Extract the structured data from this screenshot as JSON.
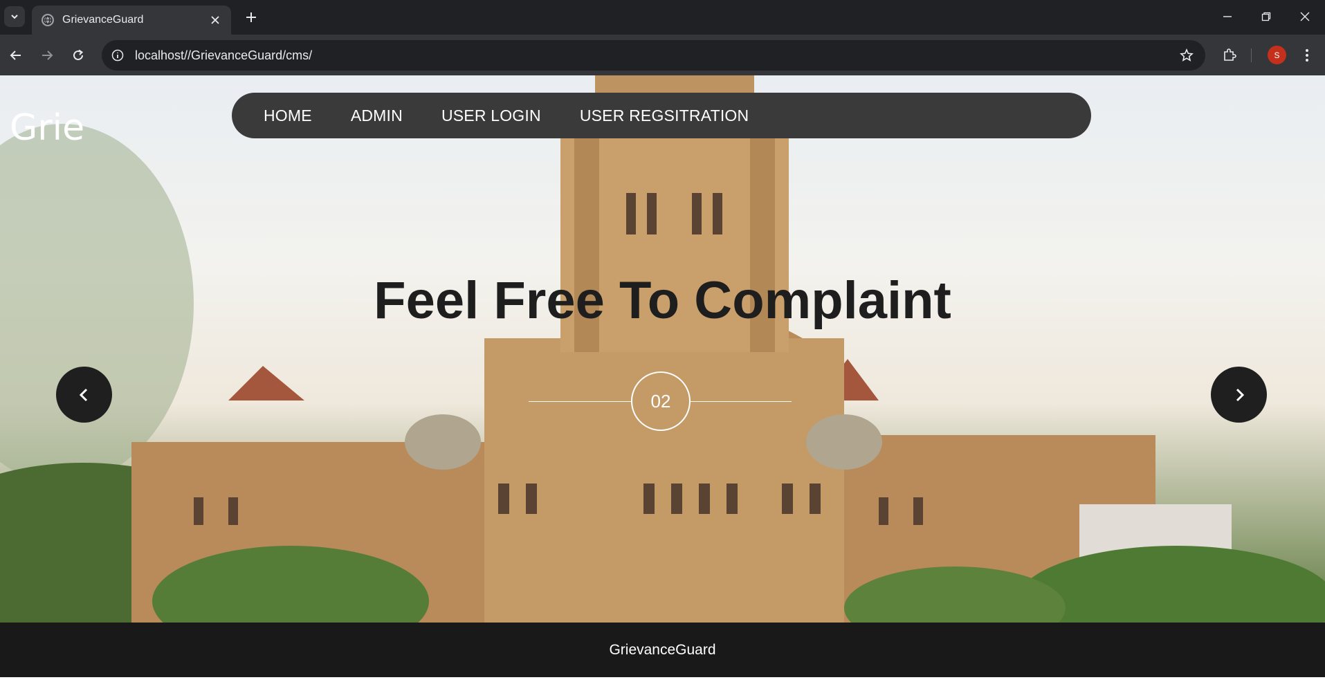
{
  "browser": {
    "tab_title": "GrievanceGuard",
    "url": "localhost//GrievanceGuard/cms/",
    "profile_initial": "S"
  },
  "site": {
    "brand": "Grie",
    "nav": [
      "HOME",
      "ADMIN",
      "USER LOGIN",
      "USER REGSITRATION"
    ]
  },
  "hero": {
    "headline": "Feel Free To Complaint",
    "slide_counter": "02"
  },
  "footer": {
    "text": "GrievanceGuard"
  }
}
